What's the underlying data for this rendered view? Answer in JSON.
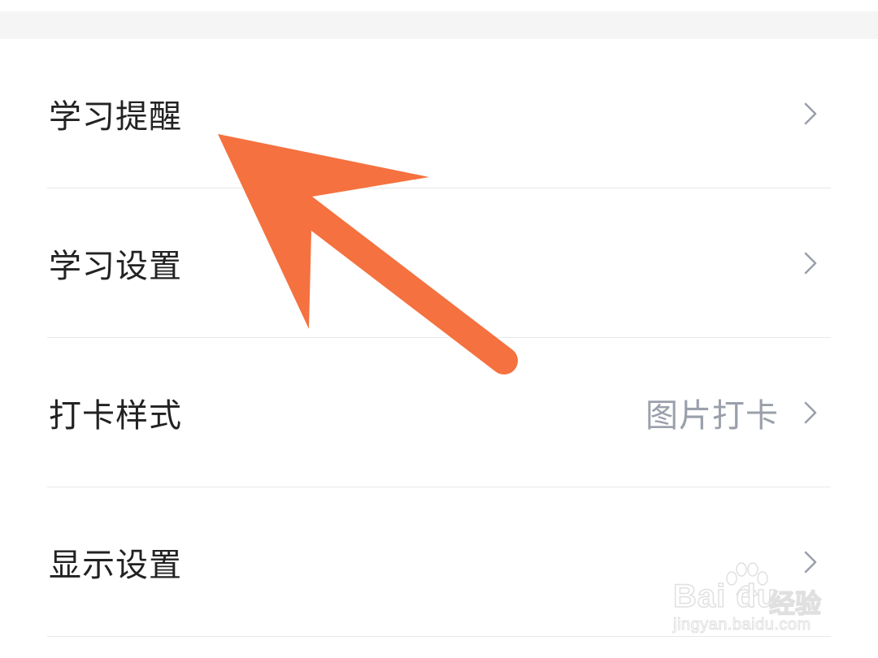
{
  "settings": {
    "items": [
      {
        "label": "学习提醒",
        "value": ""
      },
      {
        "label": "学习设置",
        "value": ""
      },
      {
        "label": "打卡样式",
        "value": "图片打卡"
      },
      {
        "label": "显示设置",
        "value": ""
      }
    ]
  },
  "annotation": {
    "arrow_color": "#f5713f",
    "arrow_icon": "pointer-arrow-icon"
  },
  "watermark": {
    "brand": "Bai du",
    "brand_cn": "经验",
    "url": "jingyan.baidu.com"
  },
  "colors": {
    "label": "#222222",
    "value": "#9aa0ab",
    "chevron": "#9aa0ab",
    "divider": "#e8e8e8",
    "top_band": "#f5f5f5"
  }
}
